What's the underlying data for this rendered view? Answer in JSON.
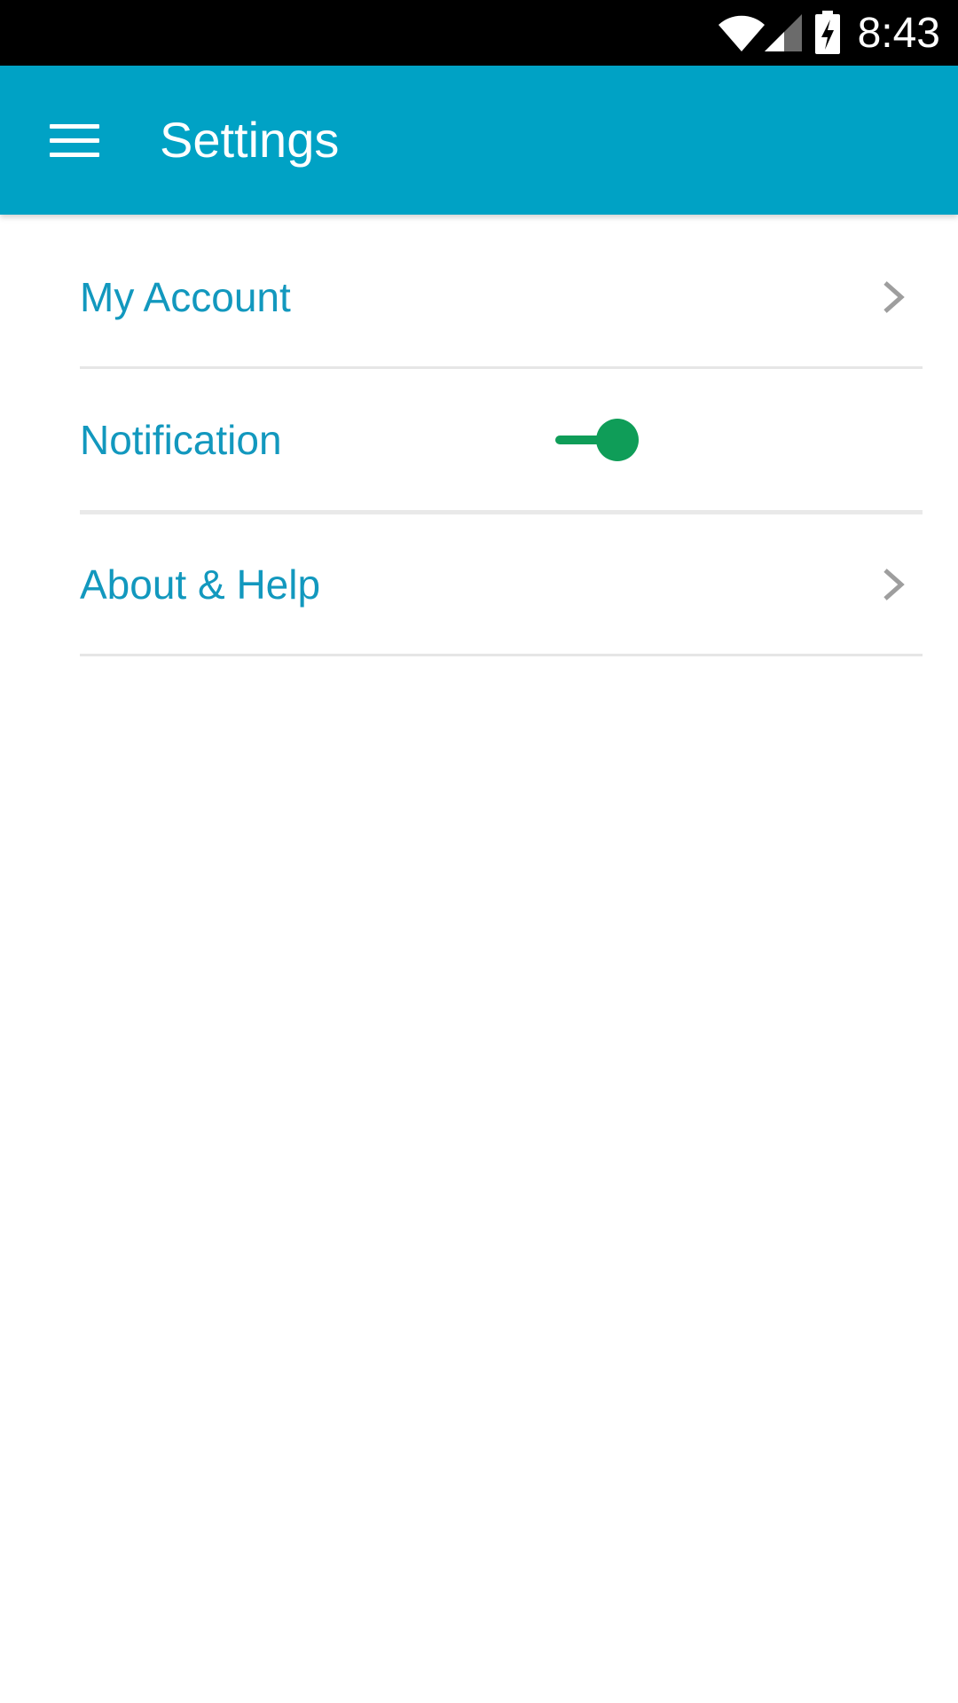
{
  "status_bar": {
    "time": "8:43",
    "icons": [
      "wifi-icon",
      "signal-icon",
      "battery-charging-icon"
    ]
  },
  "app_bar": {
    "title": "Settings",
    "menu_icon": "menu-icon",
    "color": "#00A2C5"
  },
  "settings": {
    "items": [
      {
        "label": "My Account",
        "type": "link",
        "icon": "chevron-right-icon"
      },
      {
        "label": "Notification",
        "type": "toggle",
        "enabled": true
      },
      {
        "label": "About & Help",
        "type": "link",
        "icon": "chevron-right-icon"
      }
    ]
  },
  "colors": {
    "label_text": "#1298BE",
    "toggle_on": "#0F9D58",
    "chevron": "#9e9e9e",
    "divider": "#e6e6e6"
  }
}
